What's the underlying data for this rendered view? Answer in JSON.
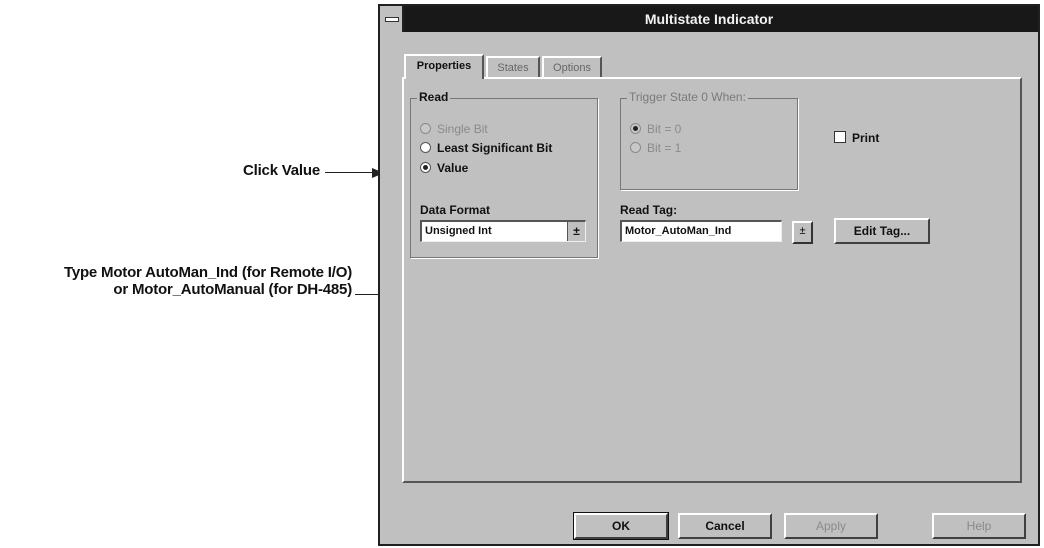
{
  "annotations": {
    "click_value": "Click Value",
    "type_line1": "Type Motor AutoMan_Ind (for Remote I/O)",
    "type_line2": "or Motor_AutoManual (for DH-485)"
  },
  "window": {
    "title": "Multistate Indicator"
  },
  "tabs": [
    {
      "label": "Properties",
      "active": true
    },
    {
      "label": "States",
      "active": false
    },
    {
      "label": "Options",
      "active": false
    }
  ],
  "read_group": {
    "label": "Read",
    "options": [
      {
        "label": "Single Bit",
        "selected": false,
        "enabled": false
      },
      {
        "label": "Least Significant Bit",
        "selected": false,
        "enabled": true
      },
      {
        "label": "Value",
        "selected": true,
        "enabled": true
      }
    ],
    "data_format_label": "Data Format",
    "data_format_value": "Unsigned Int"
  },
  "trigger_group": {
    "label": "Trigger State 0 When:",
    "options": [
      {
        "label": "Bit = 0",
        "selected": true,
        "enabled": false
      },
      {
        "label": "Bit = 1",
        "selected": false,
        "enabled": false
      }
    ]
  },
  "print_checkbox": {
    "label": "Print",
    "checked": false
  },
  "read_tag": {
    "label": "Read Tag:",
    "value": "Motor_AutoMan_Ind"
  },
  "buttons": {
    "edit_tag": "Edit Tag...",
    "ok": "OK",
    "cancel": "Cancel",
    "apply": "Apply",
    "help": "Help"
  },
  "icons": {
    "dropdown": "±"
  },
  "colors": {
    "titlebar": "#181818",
    "dialog_bg": "#c0c0c0"
  }
}
